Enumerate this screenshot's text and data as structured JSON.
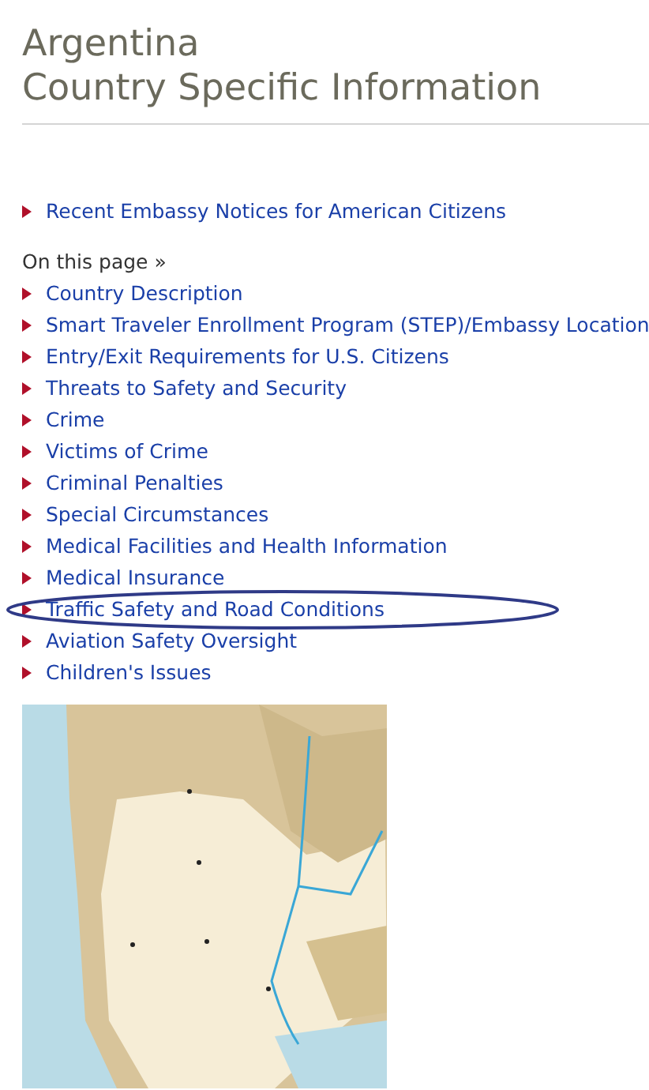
{
  "title": {
    "line_1": "Argentina",
    "line_2": "Country Specific Information"
  },
  "notices_link": "Recent Embassy Notices for American Citizens",
  "on_this_page": {
    "label": "On this page »",
    "links": [
      {
        "label": "Country Description",
        "circled": false
      },
      {
        "label": "Smart Traveler Enrollment Program (STEP)/Embassy Location",
        "circled": false
      },
      {
        "label": "Entry/Exit Requirements for U.S. Citizens",
        "circled": false
      },
      {
        "label": "Threats to Safety and Security",
        "circled": false
      },
      {
        "label": "Crime",
        "circled": false
      },
      {
        "label": "Victims of Crime",
        "circled": false
      },
      {
        "label": "Criminal Penalties",
        "circled": false
      },
      {
        "label": "Special Circumstances",
        "circled": false
      },
      {
        "label": "Medical Facilities and Health Information",
        "circled": false
      },
      {
        "label": "Medical Insurance",
        "circled": false
      },
      {
        "label": "Traffic Safety and Road Conditions",
        "circled": true
      },
      {
        "label": "Aviation Safety Oversight",
        "circled": false
      },
      {
        "label": "Children's Issues",
        "circled": false
      }
    ]
  }
}
